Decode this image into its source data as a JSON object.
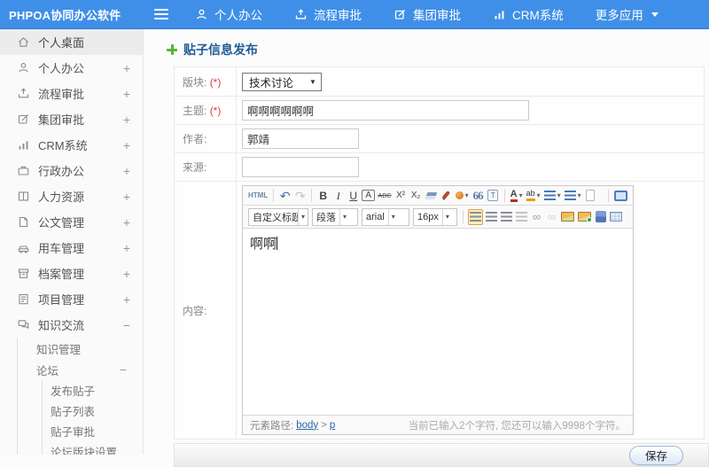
{
  "topbar": {
    "title": "PHPOA协同办公软件",
    "nav": [
      {
        "label": "个人办公"
      },
      {
        "label": "流程审批"
      },
      {
        "label": "集团审批"
      },
      {
        "label": "CRM系统"
      },
      {
        "label": "更多应用"
      }
    ]
  },
  "sidebar": {
    "items": [
      {
        "label": "个人桌面",
        "toggle": ""
      },
      {
        "label": "个人办公",
        "toggle": "+"
      },
      {
        "label": "流程审批",
        "toggle": "+"
      },
      {
        "label": "集团审批",
        "toggle": "+"
      },
      {
        "label": "CRM系统",
        "toggle": "+"
      },
      {
        "label": "行政办公",
        "toggle": "+"
      },
      {
        "label": "人力资源",
        "toggle": "+"
      },
      {
        "label": "公文管理",
        "toggle": "+"
      },
      {
        "label": "用车管理",
        "toggle": "+"
      },
      {
        "label": "档案管理",
        "toggle": "+"
      },
      {
        "label": "项目管理",
        "toggle": "+"
      },
      {
        "label": "知识交流",
        "toggle": "−"
      }
    ],
    "level2": [
      {
        "label": "知识管理",
        "toggle": ""
      },
      {
        "label": "论坛",
        "toggle": "−"
      }
    ],
    "level3": [
      {
        "label": "发布贴子"
      },
      {
        "label": "贴子列表"
      },
      {
        "label": "贴子审批"
      },
      {
        "label": "论坛版块设置"
      }
    ]
  },
  "page": {
    "title": "贴子信息发布"
  },
  "form": {
    "board_label": "版块:",
    "board_required": "(*)",
    "board_value": "技术讨论",
    "subject_label": "主题:",
    "subject_required": "(*)",
    "subject_value": "啊啊啊啊啊啊",
    "author_label": "作者:",
    "author_value": "郭靖",
    "source_label": "来源:",
    "source_value": "",
    "content_label": "内容:"
  },
  "editor": {
    "html_btn": "HTML",
    "bold": "B",
    "italic": "I",
    "underline": "U",
    "border_a": "A",
    "strike": "ABC",
    "sup": "X²",
    "sub": "X₂",
    "quote": "66",
    "paste_t": "T",
    "fontcolor_a": "A",
    "bgcolor_ab": "ab",
    "style_select": "自定义标题",
    "format_select": "段落",
    "font_select": "arial",
    "size_select": "16px",
    "content_text": "啊啊",
    "path_label": "元素路径:",
    "path_body": "body",
    "path_sep": ">",
    "path_tag": "p",
    "counter": "当前已输入2个字符, 您还可以输入9998个字符。"
  },
  "footer": {
    "save": "保存"
  },
  "icons": {
    "undo": "↶",
    "redo": "↷",
    "caret_down": "▾",
    "select_caret": "▼",
    "link": "∞",
    "unlink": "∞"
  },
  "colors": {
    "topbar": "#3F8FE8",
    "title_blue": "#1D5C95",
    "plus_green": "#52B43C",
    "required_red": "#E43B3B",
    "save_border": "#9FB9D6"
  }
}
